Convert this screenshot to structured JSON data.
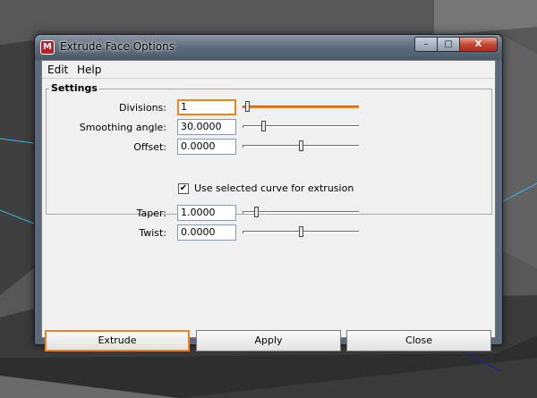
{
  "window": {
    "title": "Extrude Face Options",
    "app_icon": "maya-app-icon",
    "controls": {
      "minimize": "–",
      "maximize": "□",
      "close": "X"
    }
  },
  "menu": {
    "items": [
      {
        "label": "Edit"
      },
      {
        "label": "Help"
      }
    ]
  },
  "settings": {
    "title": "Settings",
    "divisions": {
      "label": "Divisions:",
      "value": "1",
      "slider_position": 0.02
    },
    "smoothing_angle": {
      "label": "Smoothing angle:",
      "value": "30.0000",
      "slider_position": 0.17
    },
    "offset": {
      "label": "Offset:",
      "value": "0.0000",
      "slider_position": 0.5
    },
    "use_selected_curve": {
      "label": "Use selected curve for extrusion",
      "checked": true,
      "check_glyph": "✔"
    },
    "taper": {
      "label": "Taper:",
      "value": "1.0000",
      "slider_position": 0.1
    },
    "twist": {
      "label": "Twist:",
      "value": "0.0000",
      "slider_position": 0.5
    }
  },
  "buttons": {
    "extrude": "Extrude",
    "apply": "Apply",
    "close": "Close"
  },
  "colors": {
    "accent": "#f0821e",
    "viewport_line": "#35b7e8"
  }
}
